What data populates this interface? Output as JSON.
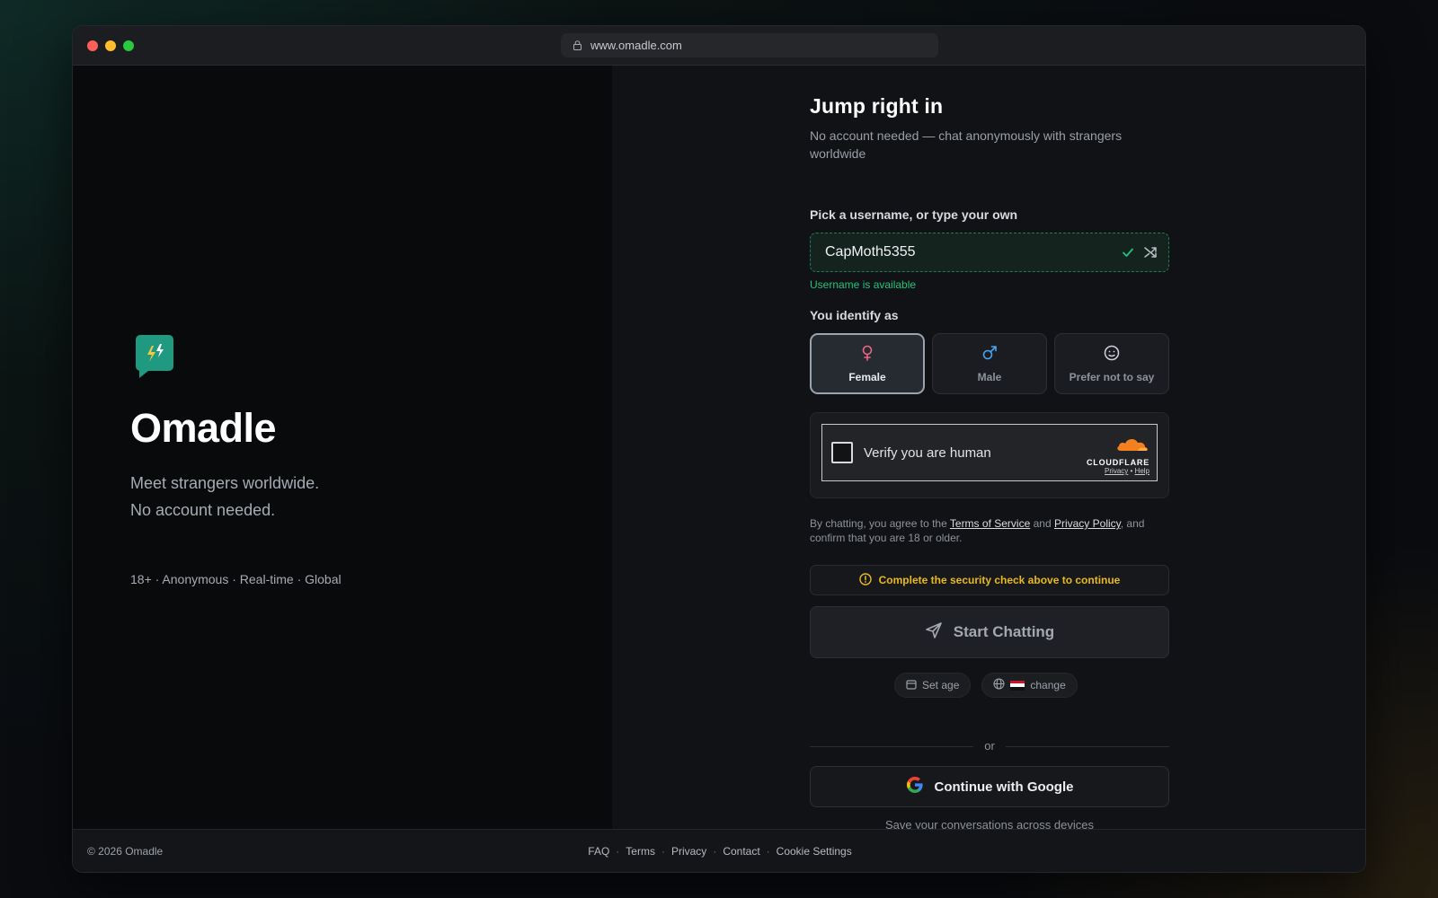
{
  "browser": {
    "url": "www.omadle.com"
  },
  "brand": {
    "name": "Omadle",
    "tagline_line1": "Meet strangers worldwide.",
    "tagline_line2": "No account needed.",
    "meta": "18+ · Anonymous · Real-time · Global",
    "accent_color": "#1f9a80"
  },
  "form": {
    "heading": "Jump right in",
    "subheading": "No account needed — chat anonymously with strangers worldwide",
    "username_label": "Pick a username, or type your own",
    "username_value": "CapMoth5355",
    "username_status": "Username is available",
    "identify_label": "You identify as",
    "genders": [
      {
        "label": "Female",
        "icon": "female-icon",
        "selected": true,
        "color": "#f0657f"
      },
      {
        "label": "Male",
        "icon": "male-icon",
        "selected": false,
        "color": "#4aa3f0"
      },
      {
        "label": "Prefer not to say",
        "icon": "neutral-face-icon",
        "selected": false,
        "color": "#cfd3d9"
      }
    ],
    "captcha": {
      "label": "Verify you are human",
      "provider": "CLOUDFLARE",
      "privacy": "Privacy",
      "help": "Help"
    },
    "terms": {
      "prefix": "By chatting, you agree to the",
      "tos": "Terms of Service",
      "and": "and",
      "privacy": "Privacy Policy",
      "suffix": ", and confirm that you are 18 or older."
    },
    "warning": "Complete the security check above to continue",
    "start_button": "Start Chatting",
    "set_age": "Set age",
    "country_change": "change",
    "divider": "or",
    "google_button": "Continue with Google",
    "google_note": "Save your conversations across devices"
  },
  "footer": {
    "copyright": "© 2026 Omadle",
    "links": [
      "FAQ",
      "Terms",
      "Privacy",
      "Contact",
      "Cookie Settings"
    ]
  }
}
